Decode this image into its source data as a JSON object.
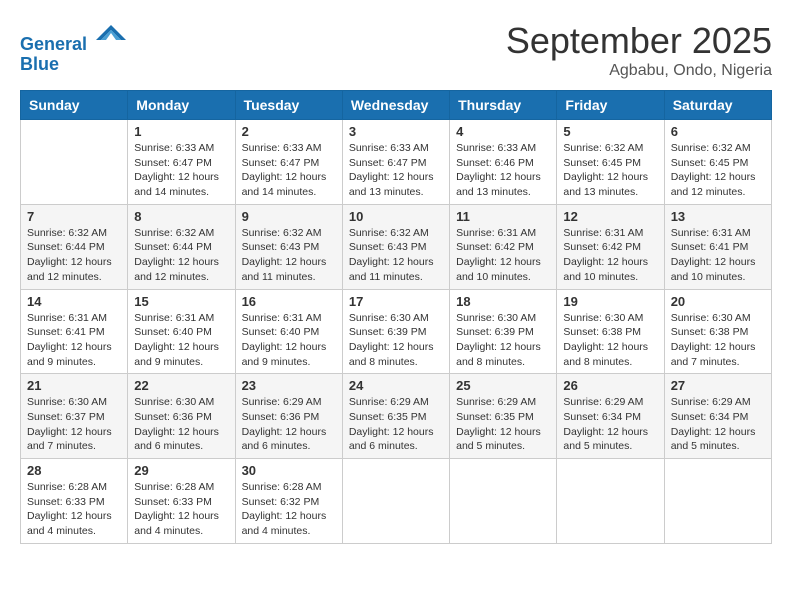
{
  "header": {
    "logo_line1": "General",
    "logo_line2": "Blue",
    "month_title": "September 2025",
    "subtitle": "Agbabu, Ondo, Nigeria"
  },
  "weekdays": [
    "Sunday",
    "Monday",
    "Tuesday",
    "Wednesday",
    "Thursday",
    "Friday",
    "Saturday"
  ],
  "weeks": [
    [
      {
        "day": "",
        "info": ""
      },
      {
        "day": "1",
        "info": "Sunrise: 6:33 AM\nSunset: 6:47 PM\nDaylight: 12 hours\nand 14 minutes."
      },
      {
        "day": "2",
        "info": "Sunrise: 6:33 AM\nSunset: 6:47 PM\nDaylight: 12 hours\nand 14 minutes."
      },
      {
        "day": "3",
        "info": "Sunrise: 6:33 AM\nSunset: 6:47 PM\nDaylight: 12 hours\nand 13 minutes."
      },
      {
        "day": "4",
        "info": "Sunrise: 6:33 AM\nSunset: 6:46 PM\nDaylight: 12 hours\nand 13 minutes."
      },
      {
        "day": "5",
        "info": "Sunrise: 6:32 AM\nSunset: 6:45 PM\nDaylight: 12 hours\nand 13 minutes."
      },
      {
        "day": "6",
        "info": "Sunrise: 6:32 AM\nSunset: 6:45 PM\nDaylight: 12 hours\nand 12 minutes."
      }
    ],
    [
      {
        "day": "7",
        "info": "Sunrise: 6:32 AM\nSunset: 6:44 PM\nDaylight: 12 hours\nand 12 minutes."
      },
      {
        "day": "8",
        "info": "Sunrise: 6:32 AM\nSunset: 6:44 PM\nDaylight: 12 hours\nand 12 minutes."
      },
      {
        "day": "9",
        "info": "Sunrise: 6:32 AM\nSunset: 6:43 PM\nDaylight: 12 hours\nand 11 minutes."
      },
      {
        "day": "10",
        "info": "Sunrise: 6:32 AM\nSunset: 6:43 PM\nDaylight: 12 hours\nand 11 minutes."
      },
      {
        "day": "11",
        "info": "Sunrise: 6:31 AM\nSunset: 6:42 PM\nDaylight: 12 hours\nand 10 minutes."
      },
      {
        "day": "12",
        "info": "Sunrise: 6:31 AM\nSunset: 6:42 PM\nDaylight: 12 hours\nand 10 minutes."
      },
      {
        "day": "13",
        "info": "Sunrise: 6:31 AM\nSunset: 6:41 PM\nDaylight: 12 hours\nand 10 minutes."
      }
    ],
    [
      {
        "day": "14",
        "info": "Sunrise: 6:31 AM\nSunset: 6:41 PM\nDaylight: 12 hours\nand 9 minutes."
      },
      {
        "day": "15",
        "info": "Sunrise: 6:31 AM\nSunset: 6:40 PM\nDaylight: 12 hours\nand 9 minutes."
      },
      {
        "day": "16",
        "info": "Sunrise: 6:31 AM\nSunset: 6:40 PM\nDaylight: 12 hours\nand 9 minutes."
      },
      {
        "day": "17",
        "info": "Sunrise: 6:30 AM\nSunset: 6:39 PM\nDaylight: 12 hours\nand 8 minutes."
      },
      {
        "day": "18",
        "info": "Sunrise: 6:30 AM\nSunset: 6:39 PM\nDaylight: 12 hours\nand 8 minutes."
      },
      {
        "day": "19",
        "info": "Sunrise: 6:30 AM\nSunset: 6:38 PM\nDaylight: 12 hours\nand 8 minutes."
      },
      {
        "day": "20",
        "info": "Sunrise: 6:30 AM\nSunset: 6:38 PM\nDaylight: 12 hours\nand 7 minutes."
      }
    ],
    [
      {
        "day": "21",
        "info": "Sunrise: 6:30 AM\nSunset: 6:37 PM\nDaylight: 12 hours\nand 7 minutes."
      },
      {
        "day": "22",
        "info": "Sunrise: 6:30 AM\nSunset: 6:36 PM\nDaylight: 12 hours\nand 6 minutes."
      },
      {
        "day": "23",
        "info": "Sunrise: 6:29 AM\nSunset: 6:36 PM\nDaylight: 12 hours\nand 6 minutes."
      },
      {
        "day": "24",
        "info": "Sunrise: 6:29 AM\nSunset: 6:35 PM\nDaylight: 12 hours\nand 6 minutes."
      },
      {
        "day": "25",
        "info": "Sunrise: 6:29 AM\nSunset: 6:35 PM\nDaylight: 12 hours\nand 5 minutes."
      },
      {
        "day": "26",
        "info": "Sunrise: 6:29 AM\nSunset: 6:34 PM\nDaylight: 12 hours\nand 5 minutes."
      },
      {
        "day": "27",
        "info": "Sunrise: 6:29 AM\nSunset: 6:34 PM\nDaylight: 12 hours\nand 5 minutes."
      }
    ],
    [
      {
        "day": "28",
        "info": "Sunrise: 6:28 AM\nSunset: 6:33 PM\nDaylight: 12 hours\nand 4 minutes."
      },
      {
        "day": "29",
        "info": "Sunrise: 6:28 AM\nSunset: 6:33 PM\nDaylight: 12 hours\nand 4 minutes."
      },
      {
        "day": "30",
        "info": "Sunrise: 6:28 AM\nSunset: 6:32 PM\nDaylight: 12 hours\nand 4 minutes."
      },
      {
        "day": "",
        "info": ""
      },
      {
        "day": "",
        "info": ""
      },
      {
        "day": "",
        "info": ""
      },
      {
        "day": "",
        "info": ""
      }
    ]
  ]
}
